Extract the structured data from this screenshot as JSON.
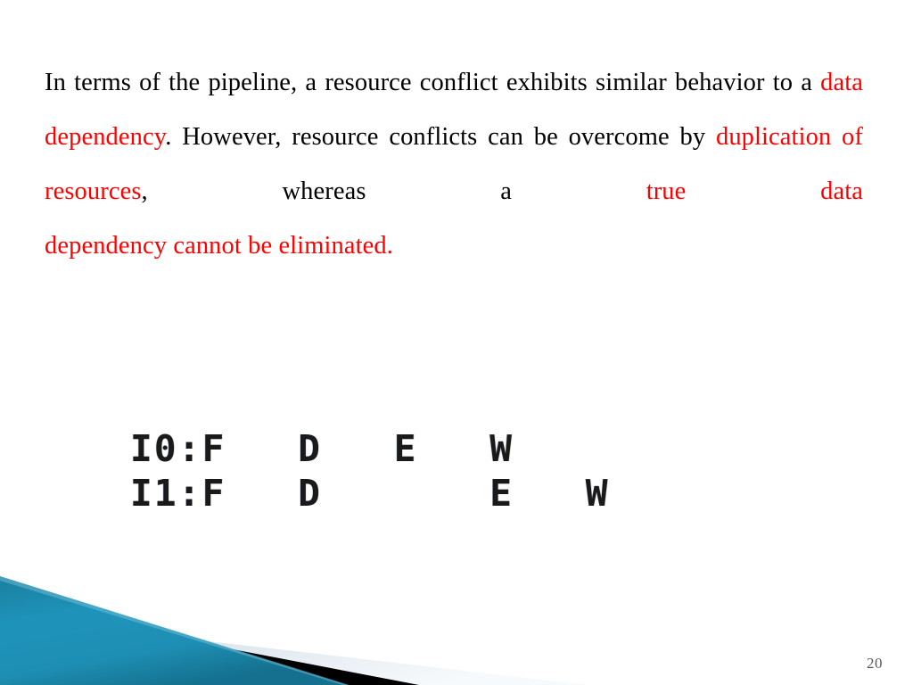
{
  "slide": {
    "page_number": "20",
    "background_color": "#FFFFFF",
    "highlight_color": "#FF0000",
    "text_color": "#000000"
  },
  "body": {
    "seg1": "In terms of the pipeline, a resource conflict exhibits similar behavior to a ",
    "seg2_highlight": "data dependency",
    "seg3": ". However, resource conflicts can be overcome by ",
    "seg4_highlight": "duplication of resources",
    "seg5": ", whereas a ",
    "seg6_highlight": "true data",
    "seg7_highlight": "dependency cannot be eliminated.",
    "full_text": "In terms of the pipeline, a resource conflict exhibits similar behavior to a data dependency. However, resource conflicts can be overcome by duplication of resources, whereas a true data dependency cannot be eliminated."
  },
  "pipeline": {
    "row0": "I0:F   D   E   W",
    "row1": "I1:F   D       E   W",
    "instructions": [
      {
        "label": "I0",
        "stages": [
          "F",
          "D",
          "E",
          "W"
        ],
        "cycles": [
          0,
          1,
          2,
          3
        ]
      },
      {
        "label": "I1",
        "stages": [
          "F",
          "D",
          "E",
          "W"
        ],
        "cycles": [
          0,
          1,
          3,
          4
        ]
      }
    ]
  },
  "decoration": {
    "teal_color": "#1C8CB2",
    "teal_color_dark": "#16718F",
    "black_color": "#000000",
    "silver_color": "#DCE6EE",
    "name": "bottom-left-diagonal-wedge"
  }
}
